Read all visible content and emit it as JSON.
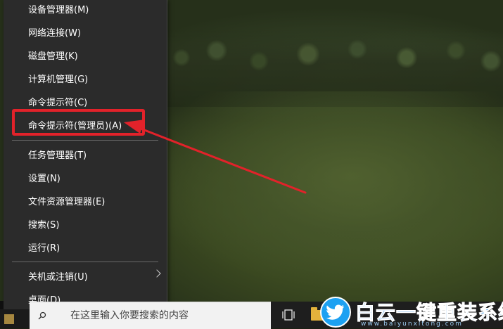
{
  "context_menu": {
    "items": [
      {
        "label": "设备管理器(M)"
      },
      {
        "label": "网络连接(W)"
      },
      {
        "label": "磁盘管理(K)"
      },
      {
        "label": "计算机管理(G)"
      },
      {
        "label": "命令提示符(C)"
      },
      {
        "label": "命令提示符(管理员)(A)",
        "highlighted": true
      },
      {
        "label": "任务管理器(T)"
      },
      {
        "label": "设置(N)"
      },
      {
        "label": "文件资源管理器(E)"
      },
      {
        "label": "搜索(S)"
      },
      {
        "label": "运行(R)"
      },
      {
        "label": "关机或注销(U)",
        "has_submenu": true
      },
      {
        "label": "桌面(D)"
      }
    ]
  },
  "search": {
    "placeholder": "在这里输入你要搜索的内容"
  },
  "watermark": {
    "title": "白云一键重装系统",
    "url": "www.baiyunxitong.com"
  },
  "colors": {
    "menu_bg": "#2b2b2b",
    "menu_text": "#ffffff",
    "annotation_red": "#e2222a",
    "watermark_blue": "#2f8fe0"
  },
  "icons": [
    "search-icon",
    "task-view-icon",
    "folder-icon",
    "chevron-right-icon",
    "twitter-bird-icon"
  ]
}
